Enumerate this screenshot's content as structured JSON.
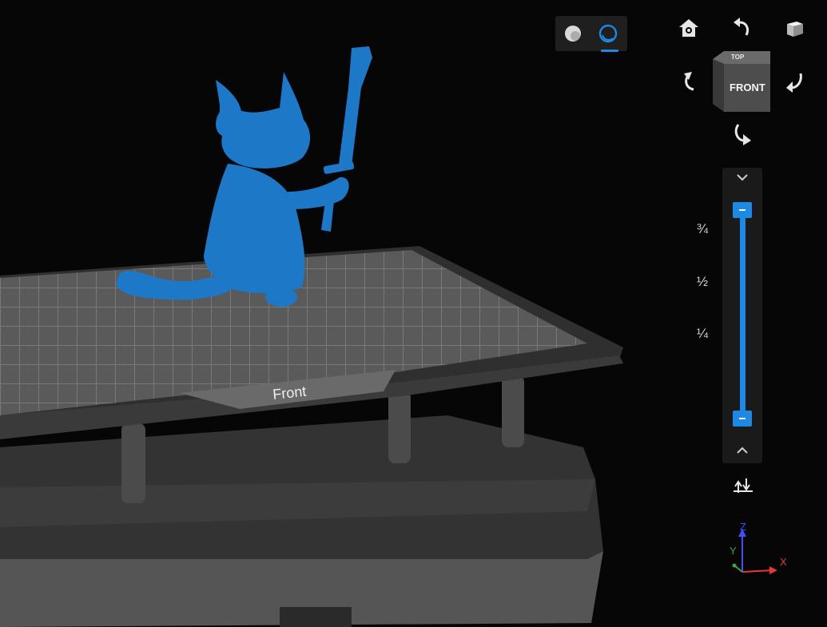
{
  "viewport": {
    "bed_label": "Front",
    "model_color": "#1e78c8",
    "background_color": "#060606"
  },
  "view_mode_toggle": {
    "options": [
      {
        "name": "solid-shaded-view",
        "icon": "sphere-shaded-icon",
        "selected": false
      },
      {
        "name": "xray-view",
        "icon": "sphere-outline-icon",
        "selected": true
      }
    ],
    "accent_color": "#1e88e5"
  },
  "view_cube": {
    "top_label": "TOP",
    "front_label": "FRONT",
    "buttons": [
      "home-view-icon",
      "rotate-up-icon",
      "3d-box-view-icon",
      "rotate-left-icon",
      "rotate-right-icon",
      "rotate-down-icon"
    ]
  },
  "layer_slider": {
    "marks": [
      "¾",
      "½",
      "¼"
    ],
    "upper_value": 1.0,
    "lower_value": 0.0
  },
  "axis_gizmo": {
    "z": "Z",
    "y": "Y",
    "x": "X",
    "colors": {
      "x": "#e53935",
      "y": "#43a047",
      "z": "#3f51f5"
    }
  }
}
